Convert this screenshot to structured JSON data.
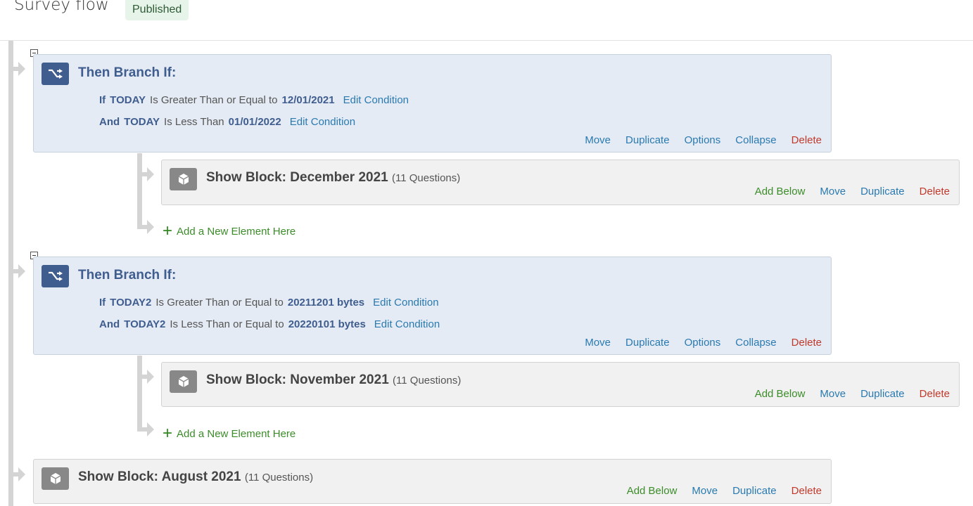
{
  "header": {
    "title": "Survey flow",
    "status_badge": "Published"
  },
  "flow": {
    "branches": [
      {
        "title": "Then Branch If:",
        "conditions": [
          {
            "conjunction": "If",
            "field": "TODAY",
            "operator": "Is Greater Than or Equal to",
            "value": "12/01/2021",
            "edit_label": "Edit Condition"
          },
          {
            "conjunction": "And",
            "field": "TODAY",
            "operator": "Is Less Than",
            "value": "01/01/2022",
            "edit_label": "Edit Condition"
          }
        ],
        "actions": {
          "move": "Move",
          "duplicate": "Duplicate",
          "options": "Options",
          "collapse": "Collapse",
          "delete": "Delete"
        },
        "child_block": {
          "title": "Show Block: December 2021",
          "question_count": "(11 Questions)",
          "actions": {
            "add_below": "Add Below",
            "move": "Move",
            "duplicate": "Duplicate",
            "delete": "Delete"
          }
        },
        "add_element_label": "Add a New Element Here"
      },
      {
        "title": "Then Branch If:",
        "conditions": [
          {
            "conjunction": "If",
            "field": "TODAY2",
            "operator": "Is Greater Than or Equal to",
            "value": "20211201 bytes",
            "edit_label": "Edit Condition"
          },
          {
            "conjunction": "And",
            "field": "TODAY2",
            "operator": "Is Less Than or Equal to",
            "value": "20220101 bytes",
            "edit_label": "Edit Condition"
          }
        ],
        "actions": {
          "move": "Move",
          "duplicate": "Duplicate",
          "options": "Options",
          "collapse": "Collapse",
          "delete": "Delete"
        },
        "child_block": {
          "title": "Show Block: November 2021",
          "question_count": "(11 Questions)",
          "actions": {
            "add_below": "Add Below",
            "move": "Move",
            "duplicate": "Duplicate",
            "delete": "Delete"
          }
        },
        "add_element_label": "Add a New Element Here"
      }
    ],
    "blocks": [
      {
        "title": "Show Block: August 2021",
        "question_count": "(11 Questions)",
        "actions": {
          "add_below": "Add Below",
          "move": "Move",
          "duplicate": "Duplicate",
          "delete": "Delete"
        }
      }
    ]
  },
  "colors": {
    "branch_accent": "#3f5d8e",
    "link_blue": "#2a7ab0",
    "link_green": "#3c8c2a",
    "delete_red": "#c0392b"
  }
}
